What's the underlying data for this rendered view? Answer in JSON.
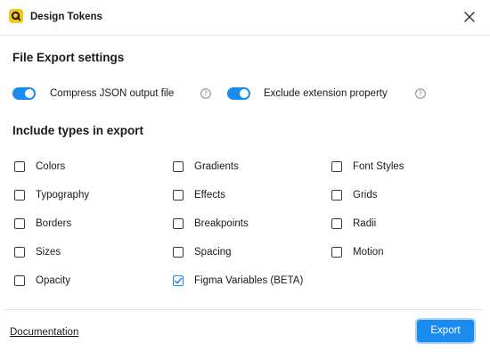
{
  "window": {
    "title": "Design Tokens",
    "accent_color": "#1a8cf0",
    "app_icon_color": "#f5c518"
  },
  "export_settings": {
    "title": "File Export settings",
    "options": [
      {
        "label": "Compress JSON output file",
        "enabled": true
      },
      {
        "label": "Exclude extension property",
        "enabled": true
      }
    ]
  },
  "types": {
    "title": "Include types in export",
    "items": [
      {
        "label": "Colors",
        "checked": false
      },
      {
        "label": "Typography",
        "checked": false
      },
      {
        "label": "Borders",
        "checked": false
      },
      {
        "label": "Sizes",
        "checked": false
      },
      {
        "label": "Opacity",
        "checked": false
      },
      {
        "label": "Gradients",
        "checked": false
      },
      {
        "label": "Effects",
        "checked": false
      },
      {
        "label": "Breakpoints",
        "checked": false
      },
      {
        "label": "Spacing",
        "checked": false
      },
      {
        "label": "Figma Variables (BETA)",
        "checked": true
      },
      {
        "label": "Font Styles",
        "checked": false
      },
      {
        "label": "Grids",
        "checked": false
      },
      {
        "label": "Radii",
        "checked": false
      },
      {
        "label": "Motion",
        "checked": false
      }
    ]
  },
  "footer": {
    "documentation_label": "Documentation",
    "export_label": "Export"
  }
}
